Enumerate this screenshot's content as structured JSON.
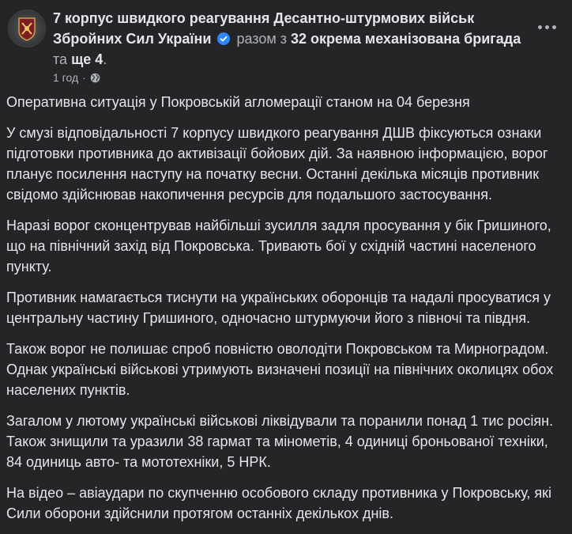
{
  "post": {
    "author": "7 корпус швидкого реагування Десантно-штурмових військ Збройних Сил України",
    "with_text": "разом з",
    "coauthor": "32 окрема механізована бригада",
    "and_text": "та",
    "more_text": "ще 4",
    "period": ".",
    "time": "1 год",
    "separator": "·",
    "paragraphs": [
      "Оперативна ситуація у Покровській агломерації станом на 04 березня",
      "У смузі відповідальності 7 корпусу швидкого реагування ДШВ фіксуються ознаки підготовки противника до активізації бойових дій. За наявною інформацією, ворог планує посилення наступу на початку весни. Останні декілька місяців противник свідомо здійснював накопичення ресурсів для подальшого застосування.",
      "Наразі ворог сконцентрував найбільші зусилля задля просування у бік Гришиного, що на північний захід від Покровська. Тривають бої у східній частині населеного пункту.",
      "Противник намагається тиснути на українських оборонців та надалі просуватися у центральну частину Гришиного, одночасно штурмуючи його з півночі та півдня.",
      "Також ворог не полишає спроб повністю оволодіти Покровськом та Мирноградом. Однак українські військові утримують визначені позиції на північних околицях обох населених пунктів.",
      "Загалом у лютому українські військові ліквідували та поранили понад 1 тис росіян. Також знищили та уразили 38 гармат та мінометів, 4 одиниці броньованої техніки, 84 одиниць авто- та мототехніки, 5 НРК.",
      "На відео – авіаудари по скупченню особового складу противника у Покровську, які Сили оборони здійснили протягом останніх декількох днів."
    ]
  },
  "icons": {
    "avatar": "unit-emblem-icon",
    "verified": "verified-badge-icon",
    "audience": "globe-icon",
    "menu": "more-options-icon"
  },
  "colors": {
    "background": "#242526",
    "text_primary": "#e4e6eb",
    "text_secondary": "#b0b3b8",
    "verified_blue": "#2d88ff"
  }
}
